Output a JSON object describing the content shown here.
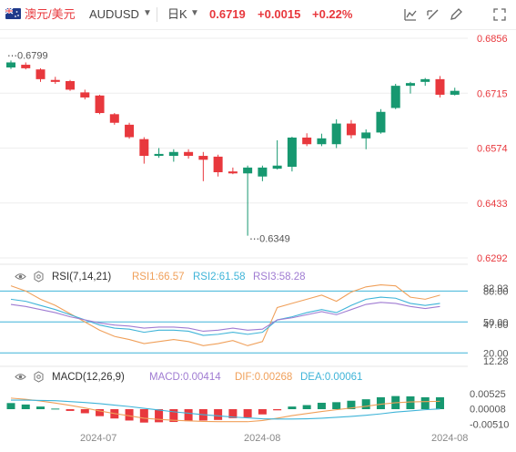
{
  "header": {
    "pair_name": "澳元/美元",
    "pair_code": "AUDUSD",
    "period": "日K",
    "last_price": "0.6719",
    "change": "+0.0015",
    "change_pct": "+0.22%",
    "up_color": "#e8383d",
    "down_color": "#179870",
    "icons": [
      "australia-flag-icon",
      "dropdown-caret-icon",
      "chart-style-icon",
      "draw-line-icon",
      "pen-icon",
      "fullscreen-icon"
    ]
  },
  "main_chart": {
    "y_ticks": [
      "0.6856",
      "0.6715",
      "0.6574",
      "0.6433",
      "0.6292"
    ],
    "high_annotation": "0.6799",
    "low_annotation": "0.6349"
  },
  "rsi": {
    "label": "RSI(7,14,21)",
    "rsi1": "RSI1:66.57",
    "rsi2": "RSI2:61.58",
    "rsi3": "RSI3:58.28",
    "y_ticks": [
      "80.00",
      "82.93",
      "50.00",
      "47.60",
      "20.00",
      "12.28"
    ],
    "colors": {
      "rsi1": "#f0a05a",
      "rsi2": "#3fb4d8",
      "rsi3": "#a07cd2",
      "level": "#3fb4d8"
    }
  },
  "macd": {
    "label": "MACD(12,26,9)",
    "macd": "MACD:0.00414",
    "dif": "DIF:0.00268",
    "dea": "DEA:0.00061",
    "y_ticks": [
      "0.00525",
      "0.00008",
      "-0.00510"
    ],
    "colors": {
      "macd": "#a07cd2",
      "dif": "#f0a05a",
      "dea": "#3fb4d8"
    }
  },
  "x_axis_labels": [
    "2024-07",
    "2024-08",
    "2024-08"
  ],
  "chart_data": {
    "type": "candlestick",
    "ylim": [
      0.6292,
      0.6856
    ],
    "candles": [
      {
        "o": 0.6781,
        "h": 0.6799,
        "l": 0.6777,
        "c": 0.6794
      },
      {
        "o": 0.6788,
        "h": 0.6794,
        "l": 0.6776,
        "c": 0.6779
      },
      {
        "o": 0.6776,
        "h": 0.6779,
        "l": 0.6744,
        "c": 0.6751
      },
      {
        "o": 0.6749,
        "h": 0.6757,
        "l": 0.6739,
        "c": 0.6744
      },
      {
        "o": 0.6746,
        "h": 0.6749,
        "l": 0.6721,
        "c": 0.6724
      },
      {
        "o": 0.6717,
        "h": 0.6724,
        "l": 0.6699,
        "c": 0.6704
      },
      {
        "o": 0.6709,
        "h": 0.6711,
        "l": 0.6661,
        "c": 0.6664
      },
      {
        "o": 0.6661,
        "h": 0.6664,
        "l": 0.6634,
        "c": 0.6639
      },
      {
        "o": 0.6634,
        "h": 0.6639,
        "l": 0.6598,
        "c": 0.6602
      },
      {
        "o": 0.6597,
        "h": 0.6602,
        "l": 0.6534,
        "c": 0.6554
      },
      {
        "o": 0.6554,
        "h": 0.6574,
        "l": 0.6549,
        "c": 0.6559
      },
      {
        "o": 0.6554,
        "h": 0.6571,
        "l": 0.6539,
        "c": 0.6564
      },
      {
        "o": 0.6564,
        "h": 0.6571,
        "l": 0.6547,
        "c": 0.6554
      },
      {
        "o": 0.6554,
        "h": 0.6564,
        "l": 0.6489,
        "c": 0.6544
      },
      {
        "o": 0.6552,
        "h": 0.6557,
        "l": 0.6501,
        "c": 0.6512
      },
      {
        "o": 0.6514,
        "h": 0.6524,
        "l": 0.6507,
        "c": 0.6509
      },
      {
        "o": 0.6509,
        "h": 0.6529,
        "l": 0.6349,
        "c": 0.6524
      },
      {
        "o": 0.6501,
        "h": 0.6529,
        "l": 0.6489,
        "c": 0.6524
      },
      {
        "o": 0.6521,
        "h": 0.6594,
        "l": 0.6519,
        "c": 0.6529
      },
      {
        "o": 0.6526,
        "h": 0.6603,
        "l": 0.6514,
        "c": 0.6601
      },
      {
        "o": 0.6601,
        "h": 0.6612,
        "l": 0.6579,
        "c": 0.6584
      },
      {
        "o": 0.6584,
        "h": 0.6611,
        "l": 0.6579,
        "c": 0.6599
      },
      {
        "o": 0.6584,
        "h": 0.6648,
        "l": 0.6574,
        "c": 0.6637
      },
      {
        "o": 0.6637,
        "h": 0.6646,
        "l": 0.6599,
        "c": 0.6607
      },
      {
        "o": 0.6599,
        "h": 0.6622,
        "l": 0.6571,
        "c": 0.6614
      },
      {
        "o": 0.6614,
        "h": 0.6674,
        "l": 0.6611,
        "c": 0.6667
      },
      {
        "o": 0.6677,
        "h": 0.6739,
        "l": 0.6674,
        "c": 0.6734
      },
      {
        "o": 0.6734,
        "h": 0.6744,
        "l": 0.6714,
        "c": 0.6741
      },
      {
        "o": 0.6744,
        "h": 0.6754,
        "l": 0.6734,
        "c": 0.6751
      },
      {
        "o": 0.6751,
        "h": 0.6759,
        "l": 0.6704,
        "c": 0.6711
      },
      {
        "o": 0.6711,
        "h": 0.6729,
        "l": 0.6709,
        "c": 0.6721
      }
    ],
    "rsi_ylim": [
      12.28,
      82.93
    ],
    "rsi1": [
      85,
      80,
      72,
      66,
      58,
      50,
      42,
      36,
      33,
      29,
      31,
      33,
      31,
      27,
      29,
      32,
      27,
      31,
      64,
      68,
      72,
      76,
      70,
      79,
      84,
      86,
      85,
      74,
      72,
      76
    ],
    "rsi2": [
      72,
      70,
      66,
      62,
      57,
      52,
      47,
      44,
      43,
      40,
      42,
      42,
      41,
      37,
      38,
      40,
      38,
      40,
      52,
      55,
      59,
      62,
      59,
      66,
      72,
      74,
      73,
      68,
      66,
      68
    ],
    "rsi3": [
      67,
      65,
      62,
      59,
      55,
      52,
      49,
      47,
      46,
      44,
      45,
      45,
      44,
      41,
      42,
      44,
      42,
      43,
      52,
      54,
      57,
      60,
      57,
      62,
      67,
      69,
      68,
      65,
      63,
      65
    ],
    "macd_ylim": [
      -0.0072,
      0.0072
    ],
    "macd_hist": [
      0.0021,
      0.0016,
      0.0009,
      0.0002,
      -0.0006,
      -0.0014,
      -0.0024,
      -0.0032,
      -0.0039,
      -0.0046,
      -0.0045,
      -0.0044,
      -0.0041,
      -0.0039,
      -0.0037,
      -0.0031,
      -0.0028,
      -0.0018,
      -0.0004,
      0.0009,
      0.0014,
      0.0022,
      0.0024,
      0.0029,
      0.0034,
      0.0041,
      0.0045,
      0.0044,
      0.0041,
      0.0041
    ],
    "dif": [
      0.0038,
      0.0034,
      0.0028,
      0.0021,
      0.0013,
      0.0004,
      -0.0006,
      -0.0015,
      -0.0023,
      -0.0031,
      -0.0035,
      -0.0038,
      -0.004,
      -0.0042,
      -0.0043,
      -0.0043,
      -0.0043,
      -0.0039,
      -0.0031,
      -0.0022,
      -0.0015,
      -0.0008,
      -0.0002,
      0.0004,
      0.001,
      0.0017,
      0.0022,
      0.0025,
      0.0026,
      0.0027
    ],
    "dea": [
      0.0031,
      0.0031,
      0.003,
      0.0029,
      0.0026,
      0.0023,
      0.0019,
      0.0014,
      0.0009,
      0.0003,
      -0.0003,
      -0.0009,
      -0.0014,
      -0.0019,
      -0.0023,
      -0.0027,
      -0.003,
      -0.0033,
      -0.0034,
      -0.0034,
      -0.0033,
      -0.0031,
      -0.0028,
      -0.0025,
      -0.0021,
      -0.0016,
      -0.001,
      -0.0006,
      -0.0002,
      0.0001
    ]
  }
}
